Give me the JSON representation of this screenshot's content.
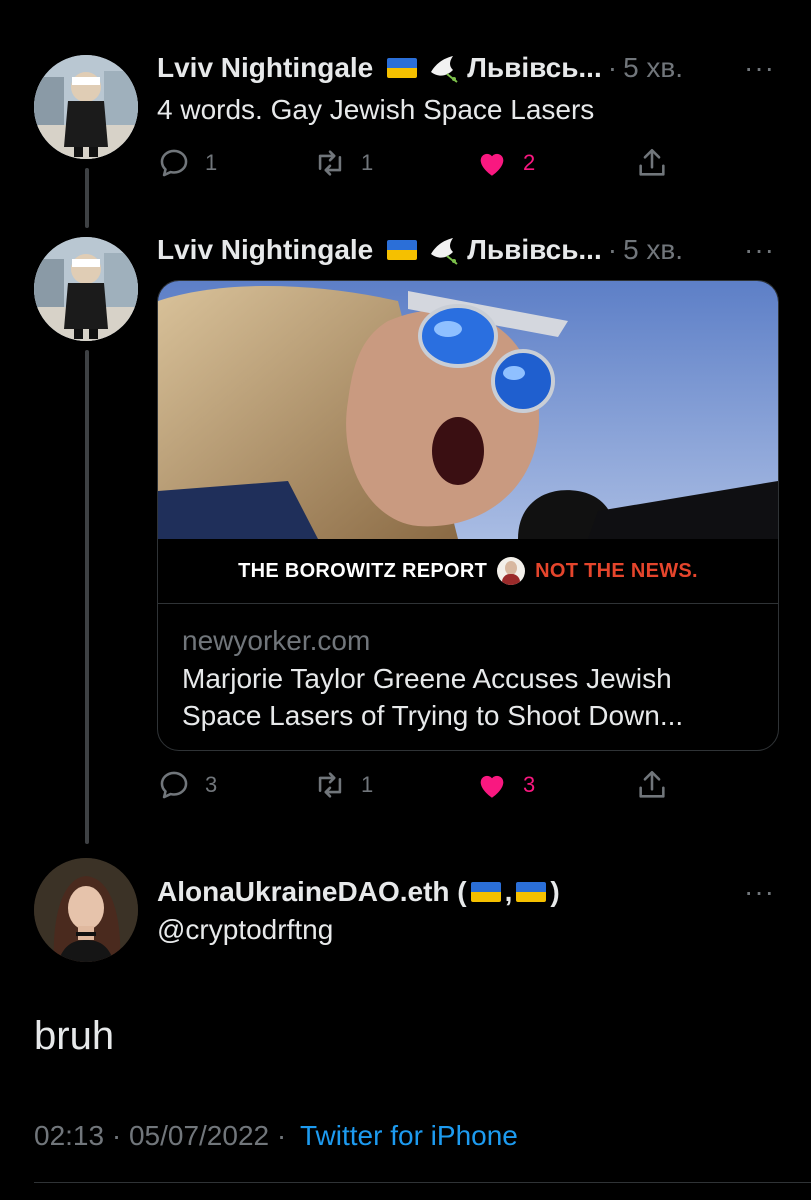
{
  "tweet1": {
    "display_name": "Lviv Nightingale",
    "name_suffix": "Львівсь...",
    "time": "5 хв.",
    "more": "···",
    "text": "4 words. Gay Jewish Space Lasers",
    "replies": "1",
    "retweets": "1",
    "likes": "2"
  },
  "tweet2": {
    "display_name": "Lviv Nightingale",
    "name_suffix": "Львівсь...",
    "time": "5 хв.",
    "more": "···",
    "card": {
      "banner_left": "THE BOROWITZ REPORT",
      "banner_right": "NOT THE NEWS.",
      "domain": "newyorker.com",
      "title_line1": "Marjorie Taylor Greene Accuses Jewish",
      "title_line2": "Space Lasers of Trying to Shoot Down..."
    },
    "replies": "3",
    "retweets": "1",
    "likes": "3"
  },
  "main_tweet": {
    "display_name": "AlonaUkraineDAO.eth (",
    "name_mid": ",",
    "name_end": ")",
    "handle": "@cryptodrftng",
    "more": "···",
    "text": "bruh",
    "timestamp": "02:13 · 05/07/2022 ·",
    "source": "Twitter for iPhone"
  },
  "colors": {
    "like": "#f91880",
    "link": "#1d9bf0",
    "muted": "#71767b",
    "flag_blue": "#2b6fd8",
    "flag_yellow": "#f5c000"
  },
  "icons": [
    "reply-icon",
    "retweet-icon",
    "heart-icon",
    "share-icon",
    "dove-icon",
    "more-icon"
  ]
}
